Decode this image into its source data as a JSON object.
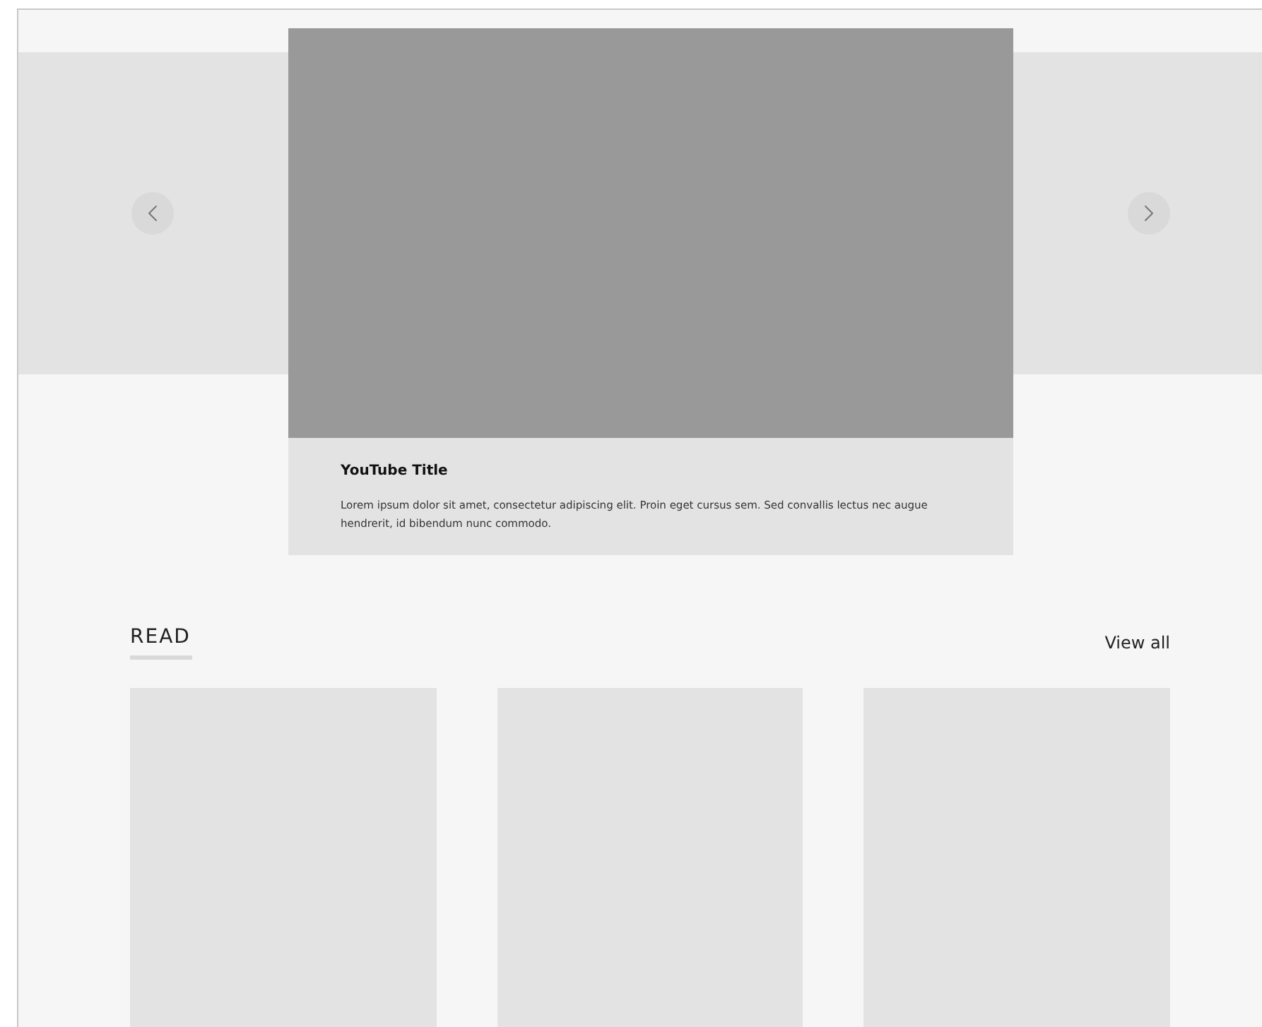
{
  "carousel": {
    "prev": {
      "kind": "prev"
    },
    "next": {
      "kind": "next"
    }
  },
  "video": {
    "title": "YouTube Title",
    "description": "Lorem ipsum dolor sit amet, consectetur adipiscing elit. Proin eget cursus sem. Sed convallis lectus nec augue hendrerit, id bibendum nunc commodo."
  },
  "section": {
    "heading": "READ",
    "link": "View all",
    "cards": [
      {
        "kind": "placeholder"
      },
      {
        "kind": "placeholder"
      },
      {
        "kind": "placeholder"
      }
    ]
  }
}
